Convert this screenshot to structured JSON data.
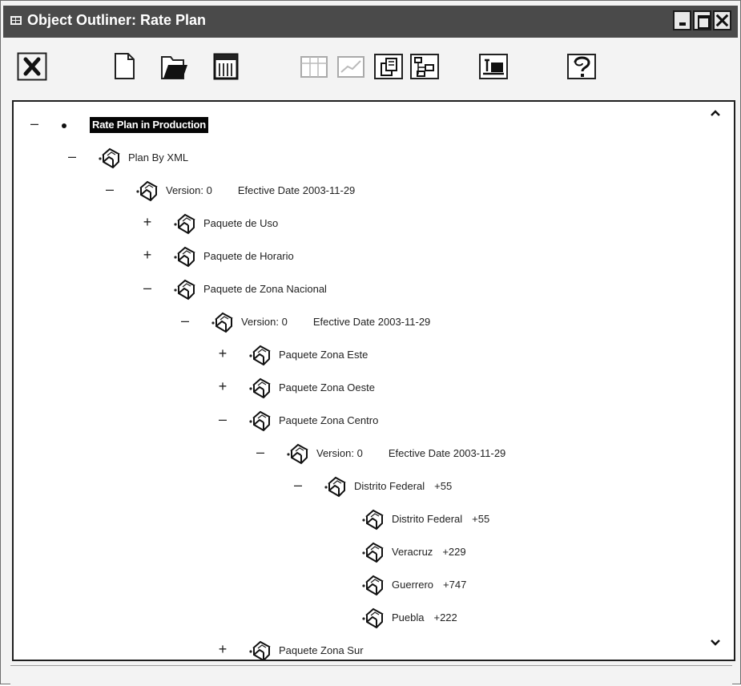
{
  "window": {
    "title": "Object Outliner: Rate Plan",
    "title_icon": "outline-grid-icon"
  },
  "toolbar": {
    "buttons": [
      {
        "name": "delete-icon",
        "enabled": true
      },
      {
        "name": "new-document-icon",
        "enabled": true
      },
      {
        "name": "open-folder-icon",
        "enabled": true
      },
      {
        "name": "calendar-grid-icon",
        "enabled": true
      },
      {
        "name": "layout-grid-icon",
        "enabled": false
      },
      {
        "name": "chart-line-icon",
        "enabled": false
      },
      {
        "name": "copy-documents-icon",
        "enabled": true
      },
      {
        "name": "hierarchy-icon",
        "enabled": true
      },
      {
        "name": "module-properties-icon",
        "enabled": true
      },
      {
        "name": "help-icon",
        "enabled": true
      }
    ]
  },
  "tree": [
    {
      "label": "Rate Plan in Production",
      "state": "collapse",
      "bullet": true,
      "selected": true
    },
    {
      "label": "Plan By XML",
      "state": "collapse",
      "bullet": false
    },
    {
      "label": "Version: 0",
      "date": "Efective Date 2003-11-29",
      "state": "collapse",
      "bullet": false
    },
    {
      "label": "Paquete de Uso",
      "state": "expand",
      "bullet": false
    },
    {
      "label": "Paquete de Horario",
      "state": "expand",
      "bullet": false
    },
    {
      "label": "Paquete de Zona Nacional",
      "state": "collapse",
      "bullet": false
    },
    {
      "label": "Version: 0",
      "date": "Efective Date 2003-11-29",
      "state": "collapse",
      "bullet": false
    },
    {
      "label": "Paquete Zona Este",
      "state": "expand",
      "bullet": false
    },
    {
      "label": "Paquete Zona Oeste",
      "state": "expand",
      "bullet": false
    },
    {
      "label": "Paquete Zona Centro",
      "state": "collapse",
      "bullet": false
    },
    {
      "label": "Version: 0",
      "date": "Efective Date 2003-11-29",
      "state": "collapse",
      "bullet": false
    },
    {
      "label": "Distrito Federal",
      "code": "+55",
      "state": "collapse",
      "bullet": false
    },
    {
      "label": "Distrito Federal",
      "code": "+55",
      "state": "none",
      "bullet": false
    },
    {
      "label": "Veracruz",
      "code": "+229",
      "state": "none",
      "bullet": false
    },
    {
      "label": "Guerrero",
      "code": "+747",
      "state": "none",
      "bullet": false
    },
    {
      "label": "Puebla",
      "code": "+222",
      "state": "none",
      "bullet": false
    },
    {
      "label": "Paquete Zona Sur",
      "state": "expand",
      "bullet": false
    }
  ]
}
